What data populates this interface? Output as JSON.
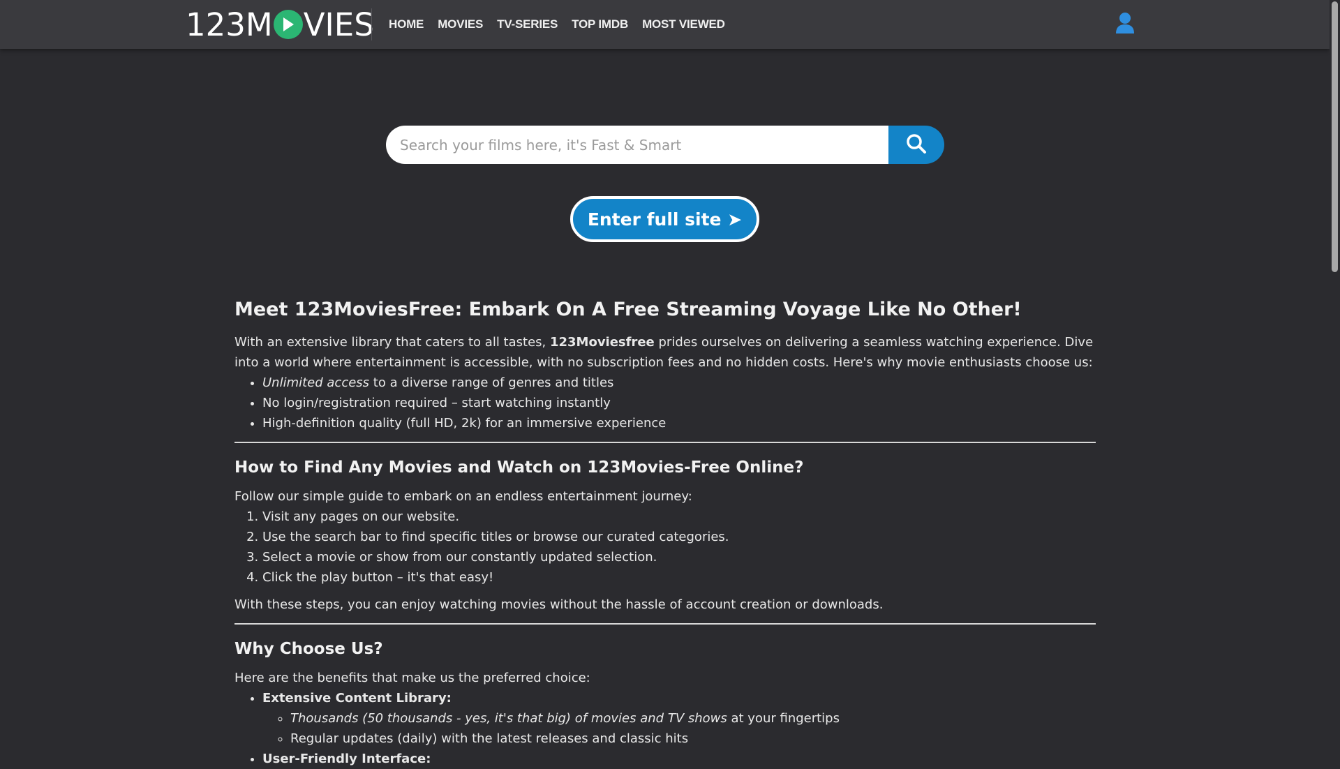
{
  "header": {
    "logo_left": "123M",
    "logo_right": "VIES",
    "nav": [
      "HOME",
      "MOVIES",
      "TV-SERIES",
      "TOP IMDB",
      "MOST VIEWED"
    ],
    "icons": {
      "play": "play-icon",
      "user": "user-icon"
    }
  },
  "search": {
    "placeholder": "Search your films here, it's Fast & Smart",
    "button_icon": "search-icon"
  },
  "enter_button": "Enter full site ➤",
  "colors": {
    "accent": "#1384c8",
    "logo_green": "#2bb673",
    "background": "#2b2b2f",
    "header": "#3a3a3e"
  },
  "article": {
    "h1": "Meet 123MoviesFree: Embark On A Free Streaming Voyage Like No Other!",
    "intro_pre": "With an extensive library that caters to all tastes, ",
    "intro_bold": "123Moviesfree",
    "intro_post": " prides ourselves on delivering a seamless watching experience. Dive into a world where entertainment is accessible, with no subscription fees and no hidden costs. Here's why movie enthusiasts choose us:",
    "list1": {
      "item1_em": "Unlimited access",
      "item1_rest": " to a diverse range of genres and titles",
      "item2": "No login/registration required – start watching instantly",
      "item3": "High-definition quality (full HD, 2k) for an immersive experience"
    },
    "h2_find": "How to Find Any Movies and Watch on 123Movies-Free Online?",
    "find_intro": "Follow our simple guide to embark on an endless entertainment journey:",
    "steps": [
      "Visit any pages on our website.",
      "Use the search bar to find specific titles or browse our curated categories.",
      "Select a movie or show from our constantly updated selection.",
      "Click the play button – it's that easy!"
    ],
    "find_outro": "With these steps, you can enjoy watching movies without the hassle of account creation or downloads.",
    "h2_why": "Why Choose Us?",
    "why_intro": "Here are the benefits that make us the preferred choice:",
    "benefit1": "Extensive Content Library:",
    "benefit1_sub1_em": "Thousands (50 thousands - yes, it's that big) of movies and TV shows",
    "benefit1_sub1_rest": " at your fingertips",
    "benefit1_sub2": "Regular updates (daily) with the latest releases and classic hits",
    "benefit2": "User-Friendly Interface:"
  }
}
